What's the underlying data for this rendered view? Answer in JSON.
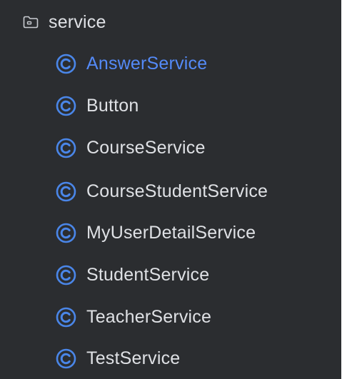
{
  "tree": {
    "folder": {
      "label": "service",
      "icon": "folder-icon"
    },
    "items": [
      {
        "label": "AnswerService",
        "icon": "class-icon",
        "selected": true
      },
      {
        "label": "Button",
        "icon": "class-icon",
        "selected": false
      },
      {
        "label": "CourseService",
        "icon": "class-icon",
        "selected": false
      },
      {
        "label": "CourseStudentService",
        "icon": "class-icon",
        "selected": false
      },
      {
        "label": "MyUserDetailService",
        "icon": "class-icon",
        "selected": false
      },
      {
        "label": "StudentService",
        "icon": "class-icon",
        "selected": false
      },
      {
        "label": "TeacherService",
        "icon": "class-icon",
        "selected": false
      },
      {
        "label": "TestService",
        "icon": "class-icon",
        "selected": false
      }
    ]
  },
  "colors": {
    "panel_bg": "#2b2d30",
    "text": "#dfe1e5",
    "selected_text": "#548af7",
    "class_icon": "#4a86e8"
  }
}
